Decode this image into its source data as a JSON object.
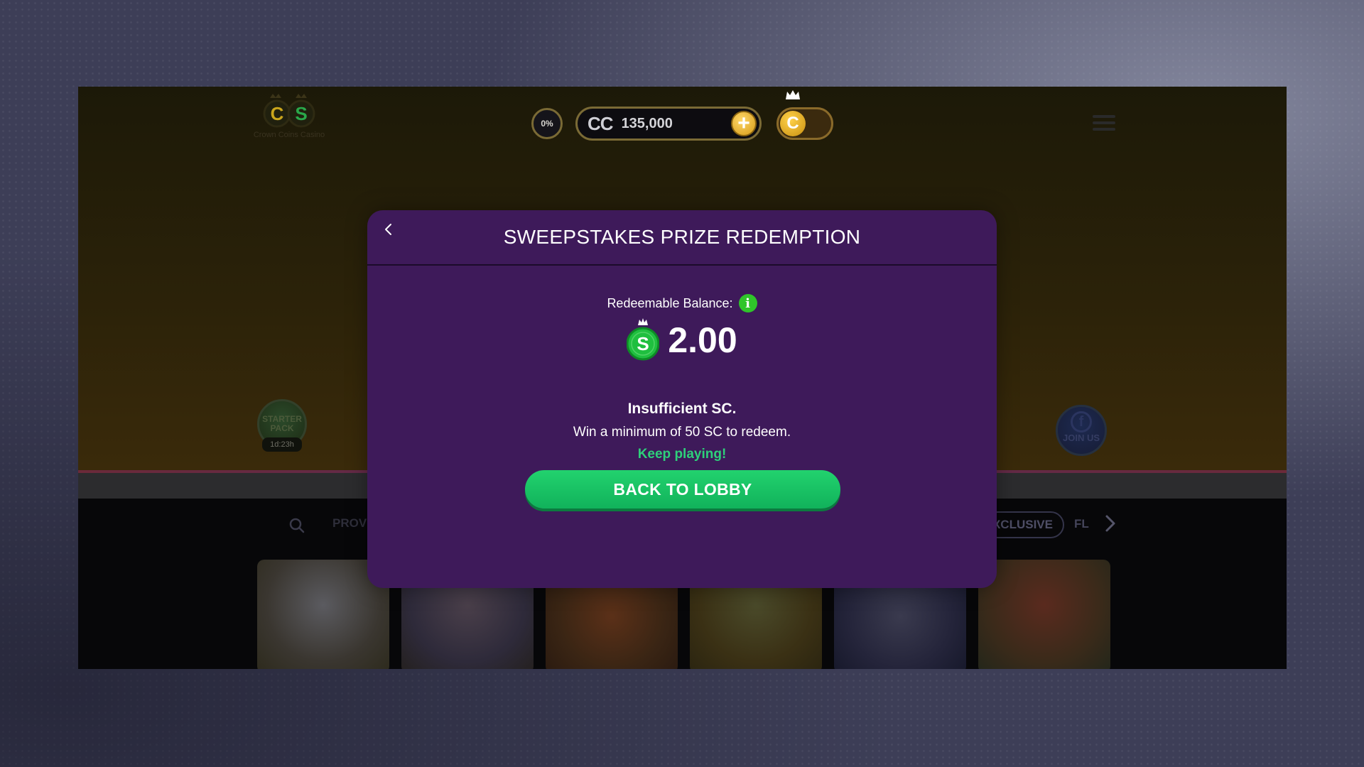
{
  "header": {
    "logo_text": "Crown Coins Casino",
    "xp_percent": "0%",
    "coins_currency": "CC",
    "coins_balance": "135,000",
    "add_coins_symbol": "+",
    "toggle_coin_letter": "C"
  },
  "hero": {
    "starter_pack_label": "STARTER PACK",
    "starter_pack_timer": "1d:23h",
    "join_us_label": "JOIN US"
  },
  "filters": {
    "partial_left": "PROV",
    "exclusive_label": "XCLUSIVE",
    "partial_right": "FL"
  },
  "modal": {
    "title": "SWEEPSTAKES PRIZE REDEMPTION",
    "balance_label": "Redeemable Balance:",
    "info_symbol": "i",
    "coin_letter": "S",
    "amount": "2.00",
    "status_title": "Insufficient SC.",
    "status_message": "Win a minimum of 50 SC to redeem.",
    "encouragement": "Keep playing!",
    "lobby_button": "BACK TO LOBBY"
  },
  "colors": {
    "modal_bg": "#3e1a5a",
    "accent_green": "#2ed07a",
    "button_green": "#1bc466",
    "coin_gold": "#f4b400"
  },
  "icons": [
    "back-icon",
    "info-icon",
    "sc-coin-icon",
    "crown-icon",
    "menu-icon",
    "search-icon",
    "chevron-right-icon",
    "plus-icon",
    "facebook-icon"
  ]
}
